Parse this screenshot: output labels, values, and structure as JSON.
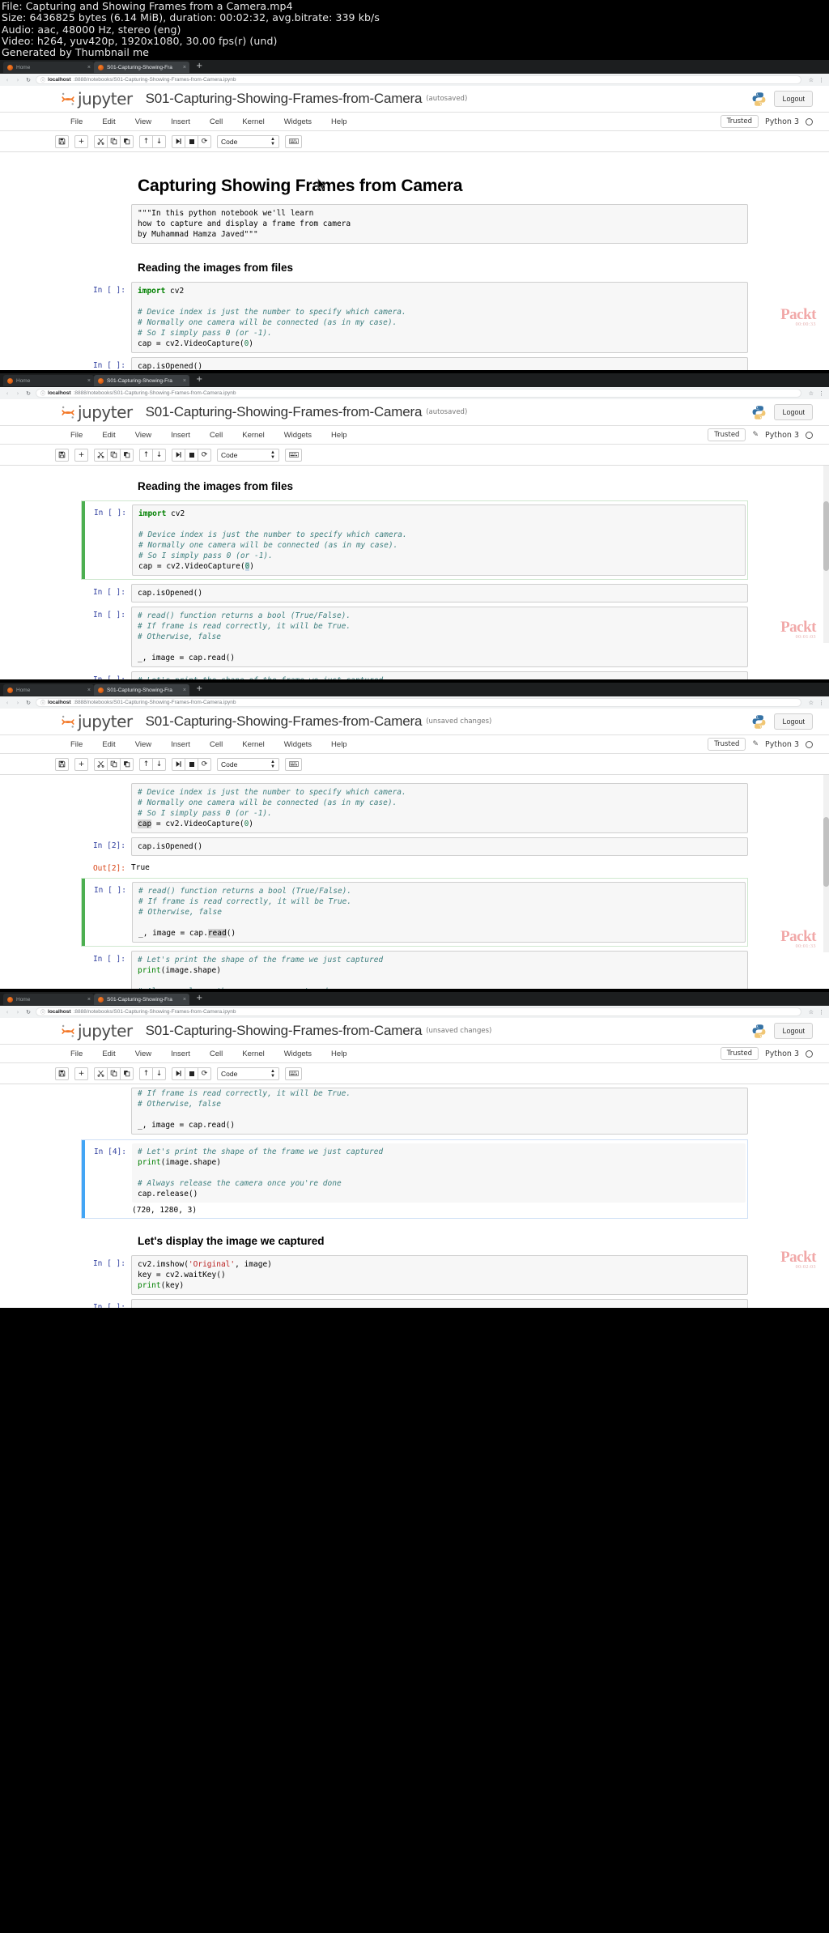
{
  "meta": {
    "line1": "File: Capturing and Showing Frames from a Camera.mp4",
    "line2": "Size: 6436825 bytes (6.14 MiB), duration: 00:02:32, avg.bitrate: 339 kb/s",
    "line3": "Audio: aac, 48000 Hz, stereo (eng)",
    "line4": "Video: h264, yuv420p, 1920x1080, 30.00 fps(r) (und)",
    "line5": "Generated by Thumbnail me"
  },
  "browser": {
    "tab_home": "Home",
    "tab_notebook": "S01-Capturing-Showing-Fra",
    "new_tab": "+",
    "close_glyph": "×",
    "back": "‹",
    "forward": "›",
    "reload": "↻",
    "info_icon": "ⓘ",
    "url_host": "localhost",
    "url_path": ":8888/notebooks/S01-Capturing-Showing-Frames-from-Camera.ipynb",
    "star_icon": "☆",
    "menu_icon": "⋮"
  },
  "jupyter": {
    "brand": "jupyter",
    "notebook_name": "S01-Capturing-Showing-Frames-from-Camera",
    "logout_label": "Logout",
    "menu": [
      "File",
      "Edit",
      "View",
      "Insert",
      "Cell",
      "Kernel",
      "Widgets",
      "Help"
    ],
    "trusted_label": "Trusted",
    "pencil_icon": "✎",
    "kernel_name": "Python 3",
    "cell_type": "Code",
    "toolbar_icons": {
      "save": "💾",
      "add": "+",
      "cut": "✂",
      "copy": "⧉",
      "paste": "⎘",
      "move_up": "↑",
      "move_down": "↓",
      "run": "▶|",
      "stop": "■",
      "restart": "⟳",
      "keyboard": "⌨"
    }
  },
  "states": {
    "autosaved": "(autosaved)",
    "unsaved": "(unsaved changes)"
  },
  "watermark": {
    "big": "Packt",
    "small": "00:00:33"
  },
  "frames": [
    {
      "id": "frame-1",
      "state": "(autosaved)",
      "timestamp": "00:00:33",
      "title": "Capturing Showing Frames from Camera",
      "heading2": "Reading the images from files",
      "md_cell": "\"\"\"In this python notebook we'll learn\nhow to capture and display a frame from camera\nby Muhammad Hamza Javed\"\"\"",
      "cells": [
        {
          "prompt": "In [ ]:",
          "code": "import cv2\n\n# Device index is just the number to specify which camera.\n# Normally one camera will be connected (as in my case).\n# So I simply pass 0 (or -1).\ncap = cv2.VideoCapture(0)"
        },
        {
          "prompt": "In [ ]:",
          "code": "cap.isOpened()"
        }
      ]
    },
    {
      "id": "frame-2",
      "state": "(autosaved)",
      "timestamp": "00:01:03",
      "heading2": "Reading the images from files",
      "cells": [
        {
          "prompt": "In [ ]:",
          "code": "import cv2\n\n# Device index is just the number to specify which camera.\n# Normally one camera will be connected (as in my case).\n# So I simply pass 0 (or -1).\ncap = cv2.VideoCapture(0)",
          "selected": "green"
        },
        {
          "prompt": "In [ ]:",
          "code": "cap.isOpened()"
        },
        {
          "prompt": "In [ ]:",
          "code": "# read() function returns a bool (True/False).\n# If frame is read correctly, it will be True.\n# Otherwise, false\n\n_, image = cap.read()"
        },
        {
          "prompt": "In [ ]:",
          "code": "# Let's print the shape of the frame we just captured\nprint(image.shape)"
        }
      ]
    },
    {
      "id": "frame-3",
      "state": "(unsaved changes)",
      "timestamp": "00:01:33",
      "cells": [
        {
          "prompt": "",
          "code": "# Device index is just the number to specify which camera.\n# Normally one camera will be connected (as in my case).\n# So I simply pass 0 (or -1).\ncap = cv2.VideoCapture(0)"
        },
        {
          "prompt": "In [2]:",
          "code": "cap.isOpened()"
        },
        {
          "prompt": "Out[2]:",
          "output": "True"
        },
        {
          "prompt": "In [ ]:",
          "code": "# read() function returns a bool (True/False).\n# If frame is read correctly, it will be True.\n# Otherwise, false\n\n_, image = cap.read()",
          "selected": "green"
        },
        {
          "prompt": "In [ ]:",
          "code": "# Let's print the shape of the frame we just captured\nprint(image.shape)\n\n# Always release the camera once you're done\ncap.release()"
        }
      ]
    },
    {
      "id": "frame-4",
      "state": "(unsaved changes)",
      "timestamp": "00:02:03",
      "heading2": "Let's display the image we captured",
      "cells": [
        {
          "prompt": "",
          "code": "# If frame is read correctly, it will be True.\n# Otherwise, false\n\n_, image = cap.read()"
        },
        {
          "prompt": "In [4]:",
          "code": "# Let's print the shape of the frame we just captured\nprint(image.shape)\n\n# Always release the camera once you're done\ncap.release()",
          "selected": "blue"
        },
        {
          "prompt": "",
          "output": "(720, 1280, 3)"
        },
        {
          "prompt": "In [ ]:",
          "code": "cv2.imshow('Original', image)\nkey = cv2.waitKey()\nprint(key)"
        },
        {
          "prompt": "In [ ]:",
          "code": ""
        }
      ]
    }
  ]
}
